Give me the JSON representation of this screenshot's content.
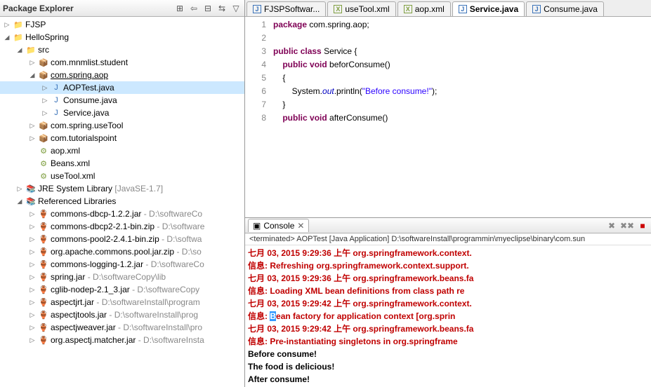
{
  "packageExplorer": {
    "title": "Package Explorer",
    "toolbar_icons": [
      "back-icon",
      "collapse-icon",
      "link-icon",
      "menu-icon"
    ],
    "tree": [
      {
        "depth": 0,
        "tw": "▷",
        "icon": "folder",
        "label": "FJSP"
      },
      {
        "depth": 0,
        "tw": "◢",
        "icon": "folder",
        "label": "HelloSpring"
      },
      {
        "depth": 1,
        "tw": "◢",
        "icon": "folder",
        "label": "src"
      },
      {
        "depth": 2,
        "tw": "▷",
        "icon": "pkg",
        "label": "com.mnmlist.student"
      },
      {
        "depth": 2,
        "tw": "◢",
        "icon": "pkg",
        "label": "com.spring.aop",
        "underline": true
      },
      {
        "depth": 3,
        "tw": "▷",
        "icon": "java",
        "label": "AOPTest.java",
        "selected": true
      },
      {
        "depth": 3,
        "tw": "▷",
        "icon": "java",
        "label": "Consume.java"
      },
      {
        "depth": 3,
        "tw": "▷",
        "icon": "java",
        "label": "Service.java"
      },
      {
        "depth": 2,
        "tw": "▷",
        "icon": "pkg",
        "label": "com.spring.useTool"
      },
      {
        "depth": 2,
        "tw": "▷",
        "icon": "pkg",
        "label": "com.tutorialspoint"
      },
      {
        "depth": 2,
        "tw": "",
        "icon": "xml",
        "label": "aop.xml"
      },
      {
        "depth": 2,
        "tw": "",
        "icon": "xml",
        "label": "Beans.xml"
      },
      {
        "depth": 2,
        "tw": "",
        "icon": "xml",
        "label": "useTool.xml"
      },
      {
        "depth": 1,
        "tw": "▷",
        "icon": "lib",
        "label": "JRE System Library",
        "suffix": " [JavaSE-1.7]"
      },
      {
        "depth": 1,
        "tw": "◢",
        "icon": "lib",
        "label": "Referenced Libraries"
      },
      {
        "depth": 2,
        "tw": "▷",
        "icon": "jar",
        "label": "commons-dbcp-1.2.2.jar",
        "suffix": " - D:\\softwareCo"
      },
      {
        "depth": 2,
        "tw": "▷",
        "icon": "jar",
        "label": "commons-dbcp2-2.1-bin.zip",
        "suffix": " - D:\\software"
      },
      {
        "depth": 2,
        "tw": "▷",
        "icon": "jar",
        "label": "commons-pool2-2.4.1-bin.zip",
        "suffix": " - D:\\softwa"
      },
      {
        "depth": 2,
        "tw": "▷",
        "icon": "jar",
        "label": "org.apache.commons.pool.jar.zip",
        "suffix": " - D:\\so"
      },
      {
        "depth": 2,
        "tw": "▷",
        "icon": "jar",
        "label": "commons-logging-1.2.jar",
        "suffix": " - D:\\softwareCo"
      },
      {
        "depth": 2,
        "tw": "▷",
        "icon": "jar",
        "label": "spring.jar",
        "suffix": " - D:\\softwareCopy\\lib"
      },
      {
        "depth": 2,
        "tw": "▷",
        "icon": "jar",
        "label": "cglib-nodep-2.1_3.jar",
        "suffix": " - D:\\softwareCopy"
      },
      {
        "depth": 2,
        "tw": "▷",
        "icon": "jar",
        "label": "aspectjrt.jar",
        "suffix": " - D:\\softwareInstall\\program"
      },
      {
        "depth": 2,
        "tw": "▷",
        "icon": "jar",
        "label": "aspectjtools.jar",
        "suffix": " - D:\\softwareInstall\\prog"
      },
      {
        "depth": 2,
        "tw": "▷",
        "icon": "jar",
        "label": "aspectjweaver.jar",
        "suffix": " - D:\\softwareInstall\\pro"
      },
      {
        "depth": 2,
        "tw": "▷",
        "icon": "jar",
        "label": "org.aspectj.matcher.jar",
        "suffix": " - D:\\softwareInsta"
      }
    ]
  },
  "editorTabs": [
    {
      "type": "j",
      "label": "FJSPSoftwar..."
    },
    {
      "type": "x",
      "label": "useTool.xml"
    },
    {
      "type": "x",
      "label": "aop.xml"
    },
    {
      "type": "j",
      "label": "Service.java",
      "active": true
    },
    {
      "type": "j",
      "label": "Consume.java"
    }
  ],
  "code": {
    "lines": [
      {
        "n": "1",
        "html": "<span class='kw'>package</span> com.spring.aop;"
      },
      {
        "n": "2",
        "html": ""
      },
      {
        "n": "3",
        "html": "<span class='kw'>public</span> <span class='kw'>class</span> <span class='cls'>Service</span> {"
      },
      {
        "n": "4",
        "html": "    <span class='kw'>public</span> <span class='kw'>void</span> <span class='mth'>beforConsume</span>()"
      },
      {
        "n": "5",
        "html": "    {"
      },
      {
        "n": "6",
        "html": "        System.<span class='field'>out</span>.println(<span class='str'>\"Before consume!\"</span>);"
      },
      {
        "n": "7",
        "html": "    }"
      },
      {
        "n": "8",
        "html": "    <span class='kw'>public</span> <span class='kw'>void</span> <span class='mth'>afterConsume</span>()"
      }
    ]
  },
  "console": {
    "tabTitle": "Console",
    "status": "<terminated> AOPTest [Java Application] D:\\softwareInstall\\programmin\\myeclipse\\binary\\com.sun",
    "lines": [
      {
        "cls": "red",
        "text": "七月 03, 2015 9:29:36 上午 org.springframework.context."
      },
      {
        "cls": "red",
        "text": "信息: Refreshing org.springframework.context.support."
      },
      {
        "cls": "red",
        "text": "七月 03, 2015 9:29:36 上午 org.springframework.beans.fa"
      },
      {
        "cls": "red",
        "text": "信息: Loading XML bean definitions from class path re"
      },
      {
        "cls": "red",
        "text": "七月 03, 2015 9:29:42 上午 org.springframework.context."
      },
      {
        "cls": "red",
        "text": "信息: Bean factory for application context [org.sprin",
        "hlStart": 4,
        "hlLen": 1
      },
      {
        "cls": "red",
        "text": "七月 03, 2015 9:29:42 上午 org.springframework.beans.fa"
      },
      {
        "cls": "red",
        "text": "信息: Pre-instantiating singletons in org.springframe"
      },
      {
        "cls": "",
        "text": "Before consume!"
      },
      {
        "cls": "",
        "text": "The food is delicious!"
      },
      {
        "cls": "",
        "text": "After consume!"
      }
    ]
  }
}
